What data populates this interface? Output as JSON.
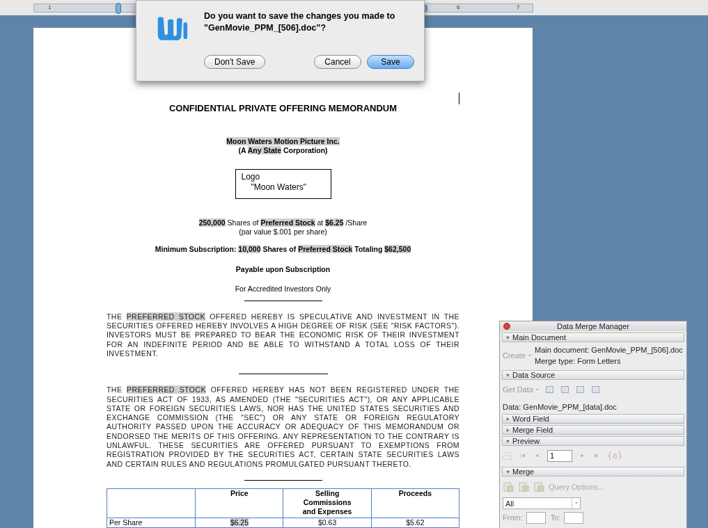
{
  "ruler": {
    "labels": [
      "1",
      "6",
      "7"
    ]
  },
  "dialog": {
    "message": [
      "Do you want to save the changes you made to",
      "\"GenMovie_PPM_[506].doc\"?"
    ],
    "buttons": [
      {
        "label": "Don't Save",
        "default": false
      },
      {
        "label": "Cancel",
        "default": false
      },
      {
        "label": "Save",
        "default": true
      }
    ]
  },
  "document": {
    "title": "CONFIDENTIAL PRIVATE OFFERING MEMORANDUM",
    "company": [
      [
        {
          "text": "Moon Waters Motion Picture Inc.",
          "field": true
        }
      ],
      [
        {
          "text": "(A ",
          "field": false
        },
        {
          "text": "Any State",
          "field": true
        },
        {
          "text": " Corporation)",
          "field": false
        }
      ]
    ],
    "logo": [
      "Logo",
      "\"Moon Waters\""
    ],
    "offering": [
      [
        {
          "text": "250,000",
          "field": true,
          "bold": true
        },
        {
          "text": " Shares of ",
          "field": false,
          "bold": false
        },
        {
          "text": "Preferred Stock",
          "field": true,
          "bold": true
        },
        {
          "text": " at ",
          "field": false,
          "bold": false
        },
        {
          "text": "$6.25",
          "field": true,
          "bold": true
        },
        {
          "text": " /Share",
          "field": false,
          "bold": false
        }
      ],
      [
        {
          "text": "(par value $.001 per share)",
          "field": false,
          "bold": false
        }
      ]
    ],
    "minimum": [
      {
        "text": "Minimum Subscription: ",
        "field": false
      },
      {
        "text": "10,000",
        "field": true
      },
      {
        "text": " Shares of ",
        "field": false
      },
      {
        "text": "Preferred Stock",
        "field": true
      },
      {
        "text": " Totaling ",
        "field": false
      },
      {
        "text": "$62,500",
        "field": true
      }
    ],
    "payable": "Payable upon Subscription",
    "accredited": "For Accredited Investors Only",
    "paragraphs": [
      [
        {
          "text": "THE ",
          "field": false
        },
        {
          "text": "PREFERRED STOCK",
          "field": true
        },
        {
          "text": " OFFERED HEREBY IS SPECULATIVE AND INVESTMENT IN THE SECURITIES OFFERED HEREBY INVOLVES A HIGH DEGREE OF RISK (SEE \"RISK FACTORS\").  INVESTORS MUST BE PREPARED TO BEAR THE ECONOMIC RISK OF THEIR INVESTMENT FOR AN INDEFINITE PERIOD AND BE ABLE TO WITHSTAND A TOTAL LOSS OF THEIR INVESTMENT.",
          "field": false
        }
      ],
      [
        {
          "text": "THE ",
          "field": false
        },
        {
          "text": "PREFERRED STOCK",
          "field": true
        },
        {
          "text": " OFFERED HEREBY HAS NOT BEEN REGISTERED UNDER THE SECURITIES ACT OF 1933, AS AMENDED (THE \"SECURITIES ACT\"), OR ANY APPLICABLE STATE OR FOREIGN SECURITIES LAWS, NOR HAS THE UNITED STATES SECURITIES AND EXCHANGE COMMISSION (THE \"SEC\") OR ANY STATE OR FOREIGN REGULATORY AUTHORITY PASSED UPON THE ACCURACY OR ADEQUACY OF THIS MEMORANDUM OR ENDORSED THE MERITS OF THIS OFFERING. ANY REPRESENTATION TO THE CONTRARY IS UNLAWFUL. THESE SECURITIES ARE OFFERED PURSUANT TO EXEMPTIONS FROM REGISTRATION PROVIDED BY THE SECURITIES ACT, CERTAIN STATE SECURITIES LAWS AND CERTAIN RULES AND REGULATIONS PROMULGATED PURSUANT THERETO.",
          "field": false
        }
      ]
    ],
    "table": {
      "columns": [
        "Price",
        "Selling Commissions and Expenses",
        "Proceeds"
      ],
      "rows": [
        {
          "label": "Per Share",
          "cells": [
            {
              "text": "$6.25",
              "field": true
            },
            {
              "text": "$0.63",
              "field": false
            },
            {
              "text": "$5.62",
              "field": false
            }
          ]
        }
      ]
    }
  },
  "merge_manager": {
    "title": "Data Merge Manager",
    "sections": [
      {
        "kind": "main",
        "title": "Main Document",
        "expanded": true,
        "create": "Create",
        "lines": [
          "Main document: GenMovie_PPM_[506].doc",
          "Merge type: Form Letters"
        ]
      },
      {
        "kind": "source",
        "title": "Data Source",
        "expanded": true,
        "get_data": "Get Data",
        "data": "Data: GenMovie_PPM_[data].doc"
      },
      {
        "title": "Word Field",
        "expanded": false
      },
      {
        "title": "Merge Field",
        "expanded": false
      },
      {
        "kind": "preview",
        "title": "Preview",
        "expanded": true,
        "record": "1",
        "field_codes": "{a}"
      },
      {
        "kind": "merge",
        "title": "Merge",
        "expanded": true,
        "query": "Query Options...",
        "range": "All",
        "from_label": "From:",
        "to_label": "To:"
      }
    ]
  }
}
